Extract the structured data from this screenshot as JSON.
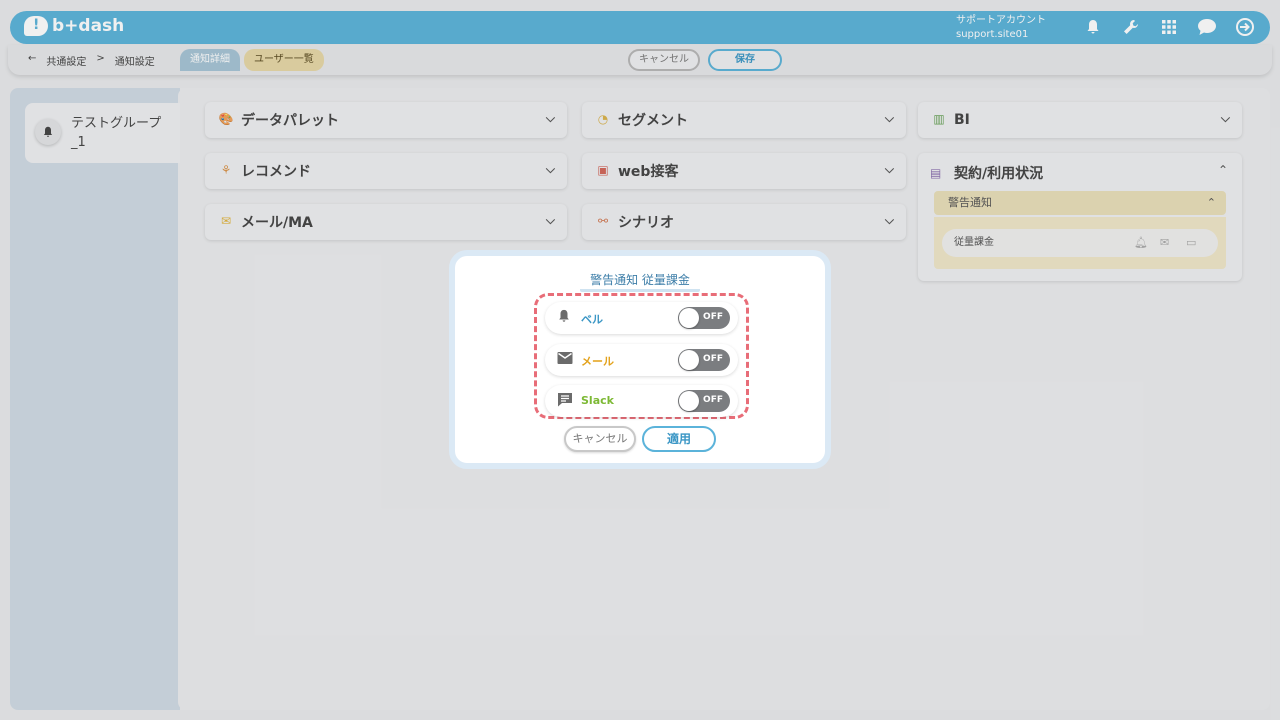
{
  "header": {
    "logo_text": "b+dash",
    "account_name": "サポートアカウント",
    "account_site": "support.site01",
    "icons": [
      "bell-icon",
      "wrench-icon",
      "grid-icon",
      "chat-icon",
      "logout-icon"
    ]
  },
  "subbar": {
    "back_arrow": "←",
    "breadcrumb": [
      "共通設定",
      ">",
      "通知設定"
    ],
    "tabs": [
      {
        "label": "通知詳細"
      },
      {
        "label": "ユーザー一覧"
      }
    ],
    "cancel_label": "キャンセル",
    "save_label": "保存"
  },
  "sidebar": {
    "groups": [
      {
        "label": "テストグループ_1"
      }
    ]
  },
  "categories": [
    {
      "label": "データパレット",
      "icon": "palette-icon"
    },
    {
      "label": "レコメンド",
      "icon": "recommend-icon"
    },
    {
      "label": "メール/MA",
      "icon": "mail-icon"
    },
    {
      "label": "セグメント",
      "icon": "segment-icon"
    },
    {
      "label": "web接客",
      "icon": "web-icon"
    },
    {
      "label": "シナリオ",
      "icon": "scenario-icon"
    },
    {
      "label": "BI",
      "icon": "bi-icon"
    },
    {
      "label": "契約/利用状況",
      "icon": "contract-icon"
    }
  ],
  "contract_panel": {
    "section_label": "警告通知",
    "item_label": "従量課金"
  },
  "modal": {
    "title": "警告通知 従量課金",
    "rows": [
      {
        "label": "ベル",
        "icon": "bell-icon",
        "color": "#3a96c5",
        "state": "OFF"
      },
      {
        "label": "メール",
        "icon": "mail-icon",
        "color": "#e3a21b",
        "state": "OFF"
      },
      {
        "label": "Slack",
        "icon": "slack-icon",
        "color": "#7db935",
        "state": "OFF"
      }
    ],
    "cancel_label": "キャンセル",
    "apply_label": "適用"
  },
  "colors": {
    "brand": "#5bb3da",
    "highlight_dash": "#e86d78"
  }
}
